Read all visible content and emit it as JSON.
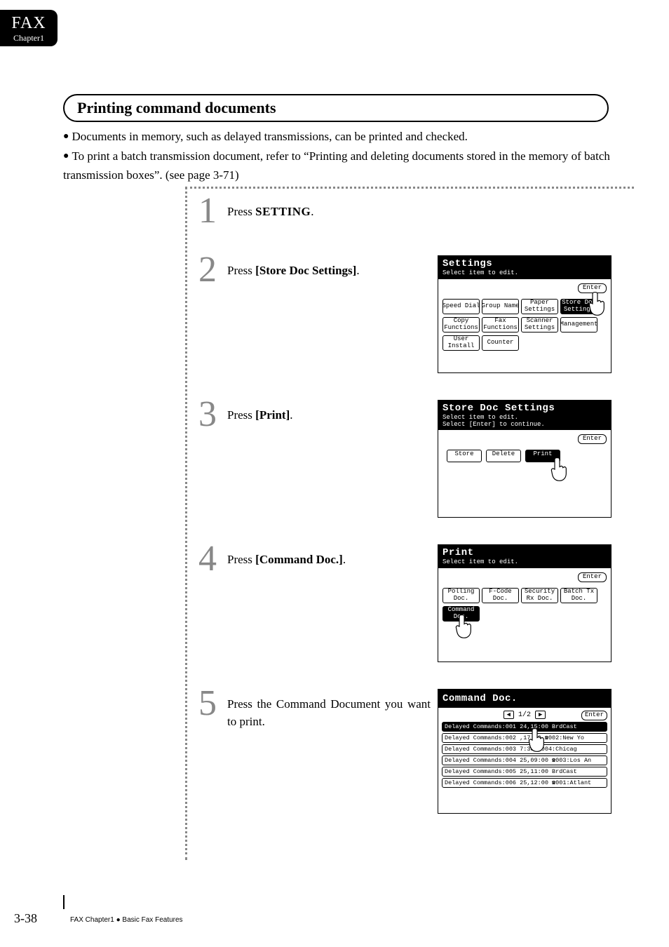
{
  "tab": {
    "line1": "FAX",
    "line2": "Chapter1"
  },
  "heading": "Printing command documents",
  "bullets": {
    "b1": "Documents in memory, such as delayed transmissions, can be printed and checked.",
    "b2": "To print a batch transmission document, refer to “Printing and deleting documents stored in the memory of batch transmission boxes”. (see page 3-71)"
  },
  "steps": {
    "s1": {
      "num": "1",
      "pre": "Press ",
      "btn": "SETTING",
      "post": "."
    },
    "s2": {
      "num": "2",
      "pre": "Press ",
      "btn": "[Store Doc Settings]",
      "post": "."
    },
    "s3": {
      "num": "3",
      "pre": "Press ",
      "btn": "[Print]",
      "post": "."
    },
    "s4": {
      "num": "4",
      "pre": "Press ",
      "btn": "[Command Doc.]",
      "post": "."
    },
    "s5": {
      "num": "5",
      "text": "Press the Command Document you want to print."
    }
  },
  "lcd_settings": {
    "title": "Settings",
    "sub": "Select item to edit.",
    "enter": "Enter",
    "row1": [
      "Speed Dial",
      "Group Name",
      "Paper\nSettings",
      "Store Doc\nSettings"
    ],
    "row2": [
      "Copy\nFunctions",
      "Fax\nFunctions",
      "Scanner\nSettings",
      "Management"
    ],
    "row3": [
      "User\nInstall",
      "Counter"
    ]
  },
  "lcd_store": {
    "title": "Store Doc Settings",
    "sub1": "Select item to edit.",
    "sub2": "Select [Enter] to continue.",
    "enter": "Enter",
    "row": [
      "Store",
      "Delete",
      "Print"
    ]
  },
  "lcd_print": {
    "title": "Print",
    "sub": "Select item to edit.",
    "enter": "Enter",
    "row1": [
      "Polling\nDoc.",
      "F-Code\nDoc.",
      "Security\nRx Doc.",
      "Batch Tx\nDoc."
    ],
    "row2": [
      "Command\nDoc."
    ]
  },
  "lcd_cmd": {
    "title": "Command Doc.",
    "pager": "1/2",
    "enter": "Enter",
    "items": [
      {
        "text": "Delayed Commands:001 24,15:00 BrdCast",
        "inv": true
      },
      {
        "text": "Delayed Commands:002  ,17:00 ☎002:New Yo",
        "inv": false
      },
      {
        "text": "Delayed Commands:003   7:30 ☎004:Chicag",
        "inv": false
      },
      {
        "text": "Delayed Commands:004 25,09:00 ☎003:Los An",
        "inv": false
      },
      {
        "text": "Delayed Commands:005 25,11:00 BrdCast",
        "inv": false
      },
      {
        "text": "Delayed Commands:006 25,12:00 ☎001:Atlant",
        "inv": false
      }
    ]
  },
  "footer": {
    "page": "3-38",
    "text": "FAX Chapter1 ● Basic Fax Features"
  }
}
